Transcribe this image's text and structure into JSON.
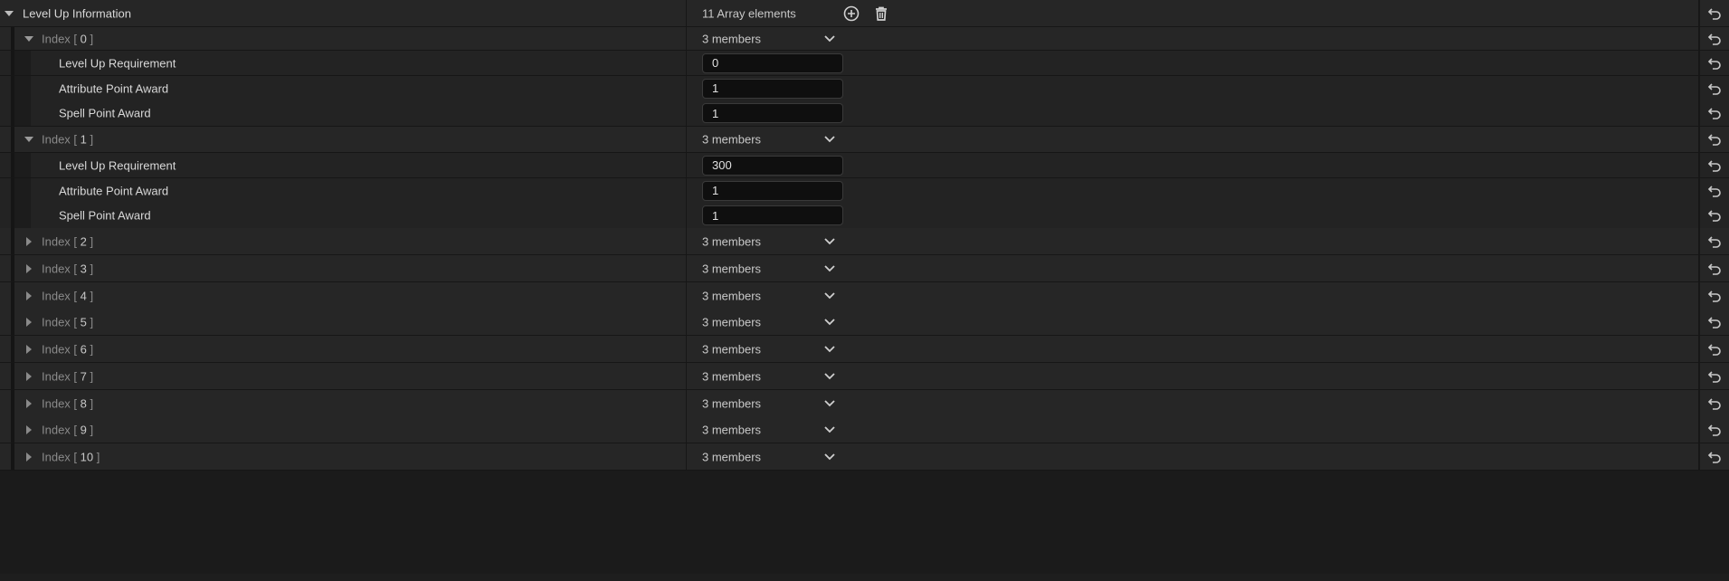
{
  "property": {
    "title": "Level Up Information",
    "count_label": "11 Array elements",
    "add_icon": "plus-circle-icon",
    "delete_icon": "trash-icon",
    "reset_icon": "reset-arrow-icon"
  },
  "elements": [
    {
      "word": "Index",
      "open": "[",
      "num": "0",
      "close": "]",
      "members": "3 members",
      "expanded": true,
      "fields": [
        {
          "label": "Level Up Requirement",
          "value": "0"
        },
        {
          "label": "Attribute Point Award",
          "value": "1"
        },
        {
          "label": "Spell Point Award",
          "value": "1"
        }
      ]
    },
    {
      "word": "Index",
      "open": "[",
      "num": "1",
      "close": "]",
      "members": "3 members",
      "expanded": true,
      "fields": [
        {
          "label": "Level Up Requirement",
          "value": "300"
        },
        {
          "label": "Attribute Point Award",
          "value": "1"
        },
        {
          "label": "Spell Point Award",
          "value": "1"
        }
      ]
    },
    {
      "word": "Index",
      "open": "[",
      "num": "2",
      "close": "]",
      "members": "3 members",
      "expanded": false,
      "fields": []
    },
    {
      "word": "Index",
      "open": "[",
      "num": "3",
      "close": "]",
      "members": "3 members",
      "expanded": false,
      "fields": []
    },
    {
      "word": "Index",
      "open": "[",
      "num": "4",
      "close": "]",
      "members": "3 members",
      "expanded": false,
      "fields": []
    },
    {
      "word": "Index",
      "open": "[",
      "num": "5",
      "close": "]",
      "members": "3 members",
      "expanded": false,
      "fields": []
    },
    {
      "word": "Index",
      "open": "[",
      "num": "6",
      "close": "]",
      "members": "3 members",
      "expanded": false,
      "fields": []
    },
    {
      "word": "Index",
      "open": "[",
      "num": "7",
      "close": "]",
      "members": "3 members",
      "expanded": false,
      "fields": []
    },
    {
      "word": "Index",
      "open": "[",
      "num": "8",
      "close": "]",
      "members": "3 members",
      "expanded": false,
      "fields": []
    },
    {
      "word": "Index",
      "open": "[",
      "num": "9",
      "close": "]",
      "members": "3 members",
      "expanded": false,
      "fields": []
    },
    {
      "word": "Index",
      "open": "[",
      "num": "10",
      "close": "]",
      "members": "3 members",
      "expanded": false,
      "fields": []
    }
  ]
}
